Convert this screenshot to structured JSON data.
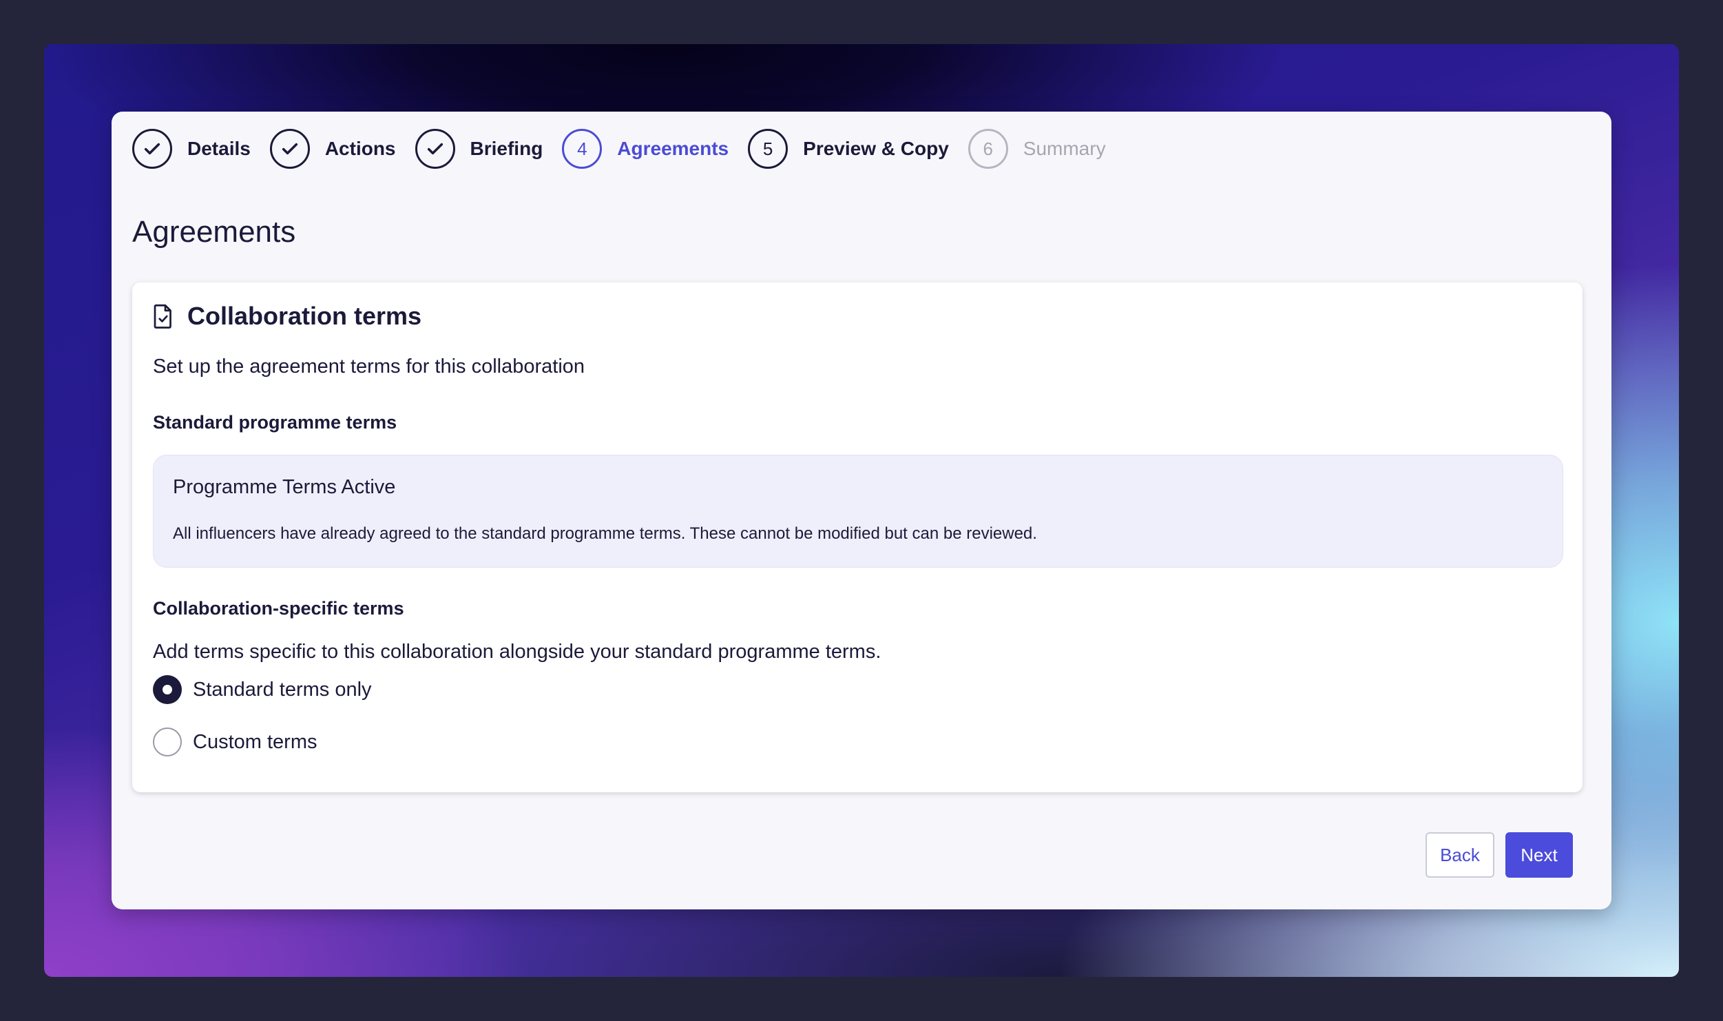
{
  "stepper": {
    "steps": [
      {
        "label": "Details",
        "state": "complete",
        "icon": "check-icon"
      },
      {
        "label": "Actions",
        "state": "complete",
        "icon": "check-icon"
      },
      {
        "label": "Briefing",
        "state": "complete",
        "icon": "check-icon"
      },
      {
        "number": "4",
        "label": "Agreements",
        "state": "active"
      },
      {
        "number": "5",
        "label": "Preview & Copy",
        "state": "pending"
      },
      {
        "number": "6",
        "label": "Summary",
        "state": "disabled"
      }
    ]
  },
  "page": {
    "title": "Agreements"
  },
  "panel": {
    "icon": "document-check-icon",
    "title": "Collaboration terms",
    "subtitle": "Set up the agreement terms for this collaboration",
    "standard": {
      "heading": "Standard programme terms",
      "info_title": "Programme Terms Active",
      "info_text": "All influencers have already agreed to the standard programme terms. These cannot be modified but can be reviewed."
    },
    "specific": {
      "heading": "Collaboration-specific terms",
      "description": "Add terms specific to this collaboration alongside your standard programme terms.",
      "options": [
        {
          "label": "Standard terms only",
          "selected": true
        },
        {
          "label": "Custom terms",
          "selected": false
        }
      ]
    }
  },
  "footer": {
    "back_label": "Back",
    "next_label": "Next"
  },
  "colors": {
    "accent": "#4b4bdc",
    "text": "#1b1a3a",
    "disabled": "#a6a6b2",
    "info_bg": "#eeeffa"
  }
}
